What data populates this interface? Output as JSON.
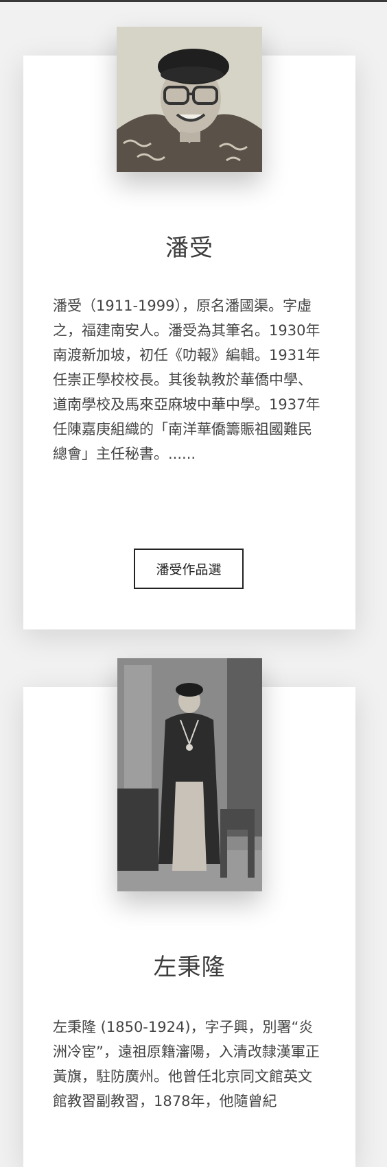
{
  "authors": [
    {
      "name": "潘受",
      "portrait_alt": "潘受 portrait photo",
      "bio": "潘受（1911-1999），原名潘國渠。字虛之，福建南安人。潘受為其筆名。1930年南渡新加坡，初任《叻報》編輯。1931年任崇正學校校長。其後執教於華僑中學、道南學校及馬來亞麻坡中華中學。1937年任陳嘉庚組織的「南洋華僑籌賑祖國難民總會」主任秘書。......",
      "button_label": "潘受作品選"
    },
    {
      "name": "左秉隆",
      "portrait_alt": "左秉隆 portrait photo",
      "bio": "左秉隆 (1850-1924)，字子興，別署“炎洲冷宦”，遠祖原籍瀋陽，入清改隸漢軍正黃旗，駐防廣州。他曾任北京同文館英文館教習副教習，1878年，他隨曾紀"
    }
  ],
  "colors": {
    "page_background": "#f1f1f1",
    "card_background": "#ffffff",
    "button_border": "#222222"
  }
}
